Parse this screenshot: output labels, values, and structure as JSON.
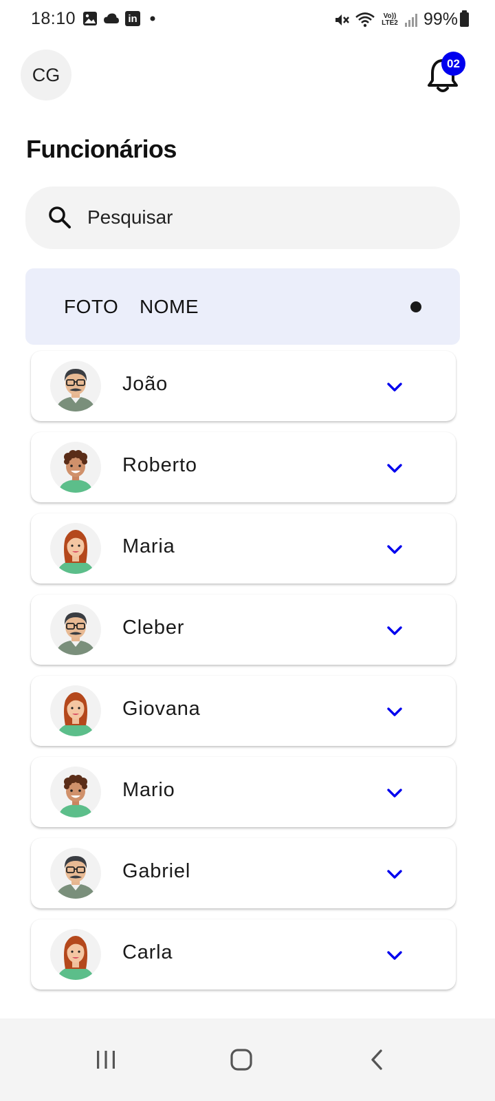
{
  "status_bar": {
    "time": "18:10",
    "battery_pct": "99%",
    "left_icons": [
      "image-icon",
      "cloud-icon",
      "linkedin-icon",
      "dot-icon"
    ],
    "right_icons": [
      "mute-icon",
      "wifi-icon",
      "volte-icon",
      "signal-icon",
      "battery-icon"
    ],
    "volte_label": "Vo)) LTE2",
    "linkedin_label": "in"
  },
  "header": {
    "user_initials": "CG",
    "notification_count": "02",
    "accent_color": "#0000ee"
  },
  "page": {
    "title": "Funcionários"
  },
  "search": {
    "placeholder": "Pesquisar",
    "value": ""
  },
  "table": {
    "columns": [
      "FOTO",
      "NOME"
    ]
  },
  "employees": [
    {
      "name": "João",
      "avatar": "man-glasses-mustache"
    },
    {
      "name": "Roberto",
      "avatar": "boy-curly-hair"
    },
    {
      "name": "Maria",
      "avatar": "woman-red-hair"
    },
    {
      "name": "Cleber",
      "avatar": "man-glasses-mustache"
    },
    {
      "name": "Giovana",
      "avatar": "woman-red-hair"
    },
    {
      "name": "Mario",
      "avatar": "boy-curly-hair"
    },
    {
      "name": "Gabriel",
      "avatar": "man-glasses-mustache"
    },
    {
      "name": "Carla",
      "avatar": "woman-red-hair"
    }
  ],
  "nav": {
    "items": [
      "recents-icon",
      "home-icon",
      "back-icon"
    ]
  }
}
